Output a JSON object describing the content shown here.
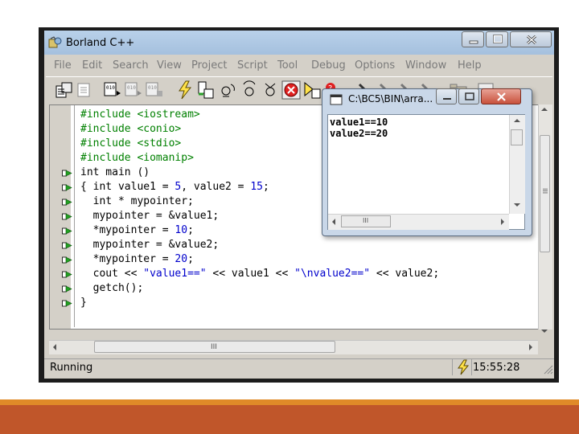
{
  "window": {
    "title": "Borland C++"
  },
  "menu": [
    "File",
    "Edit",
    "Search",
    "View",
    "Project",
    "Script",
    "Tool",
    "Debug",
    "Options",
    "Window",
    "Help"
  ],
  "code": [
    {
      "a": "#include ",
      "b": "<iostream>"
    },
    {
      "a": "#include ",
      "b": "<conio>"
    },
    {
      "a": "#include ",
      "b": "<stdio>"
    },
    {
      "a": "#include ",
      "b": "<iomanip>"
    },
    {
      "t": "int main ()"
    },
    {
      "t1": "{ int value1 = ",
      "n1": "5",
      "t2": ", value2 = ",
      "n2": "15",
      "t3": ";"
    },
    {
      "t": "  int * mypointer;"
    },
    {
      "t": "  mypointer = &value1;"
    },
    {
      "t1": "  *mypointer = ",
      "n1": "10",
      "t3": ";"
    },
    {
      "t": "  mypointer = &value2;"
    },
    {
      "t1": "  *mypointer = ",
      "n1": "20",
      "t3": ";"
    },
    {
      "t1": "  cout << ",
      "s1": "\"value1==\"",
      "t2": " << value1 << ",
      "s2": "\"\\nvalue2==\"",
      "t3": " << value2;"
    },
    {
      "t": "  getch();"
    },
    {
      "t": "}"
    }
  ],
  "console": {
    "title": "C:\\BC5\\BIN\\arra...",
    "lines": [
      "value1==10",
      "value2==20"
    ]
  },
  "status": {
    "text": "Running",
    "time": "15:55:28"
  },
  "scroll_grip": "III",
  "colors": {
    "preprocessor": "#008000",
    "number": "#0000cc",
    "string": "#0000cc",
    "orange_bar": "#e08a28",
    "rust_bar": "#c0562a"
  }
}
